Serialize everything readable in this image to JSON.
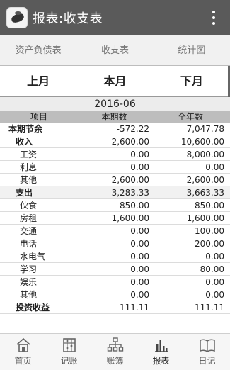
{
  "app": {
    "title": "报表:收支表"
  },
  "tabs": [
    {
      "label": "资产负债表"
    },
    {
      "label": "收支表"
    },
    {
      "label": "统计图"
    }
  ],
  "period_nav": {
    "prev": "上月",
    "current": "本月",
    "next": "下月"
  },
  "period": "2016-06",
  "table": {
    "headers": {
      "item": "项目",
      "current": "本期数",
      "ytd": "全年数"
    },
    "rows": [
      {
        "name": "本期节余",
        "current": "-572.22",
        "ytd": "7,047.78"
      },
      {
        "name": "收入",
        "current": "2,600.00",
        "ytd": "10,600.00"
      },
      {
        "name": "工资",
        "current": "0.00",
        "ytd": "8,000.00"
      },
      {
        "name": "利息",
        "current": "0.00",
        "ytd": "0.00"
      },
      {
        "name": "其他",
        "current": "2,600.00",
        "ytd": "2,600.00"
      },
      {
        "name": "支出",
        "current": "3,283.33",
        "ytd": "3,663.33"
      },
      {
        "name": "伙食",
        "current": "850.00",
        "ytd": "850.00"
      },
      {
        "name": "房租",
        "current": "1,600.00",
        "ytd": "1,600.00"
      },
      {
        "name": "交通",
        "current": "0.00",
        "ytd": "100.00"
      },
      {
        "name": "电话",
        "current": "0.00",
        "ytd": "200.00"
      },
      {
        "name": "水电气",
        "current": "0.00",
        "ytd": "0.00"
      },
      {
        "name": "学习",
        "current": "0.00",
        "ytd": "80.00"
      },
      {
        "name": "娱乐",
        "current": "0.00",
        "ytd": "0.00"
      },
      {
        "name": "其他",
        "current": "0.00",
        "ytd": "0.00"
      },
      {
        "name": "投资收益",
        "current": "111.11",
        "ytd": "111.11"
      }
    ]
  },
  "bottom_nav": [
    {
      "label": "首页",
      "icon": "home-icon"
    },
    {
      "label": "记账",
      "icon": "abacus-icon"
    },
    {
      "label": "账簿",
      "icon": "ledger-tree-icon"
    },
    {
      "label": "报表",
      "icon": "bar-chart-icon"
    },
    {
      "label": "日记",
      "icon": "book-icon"
    }
  ]
}
